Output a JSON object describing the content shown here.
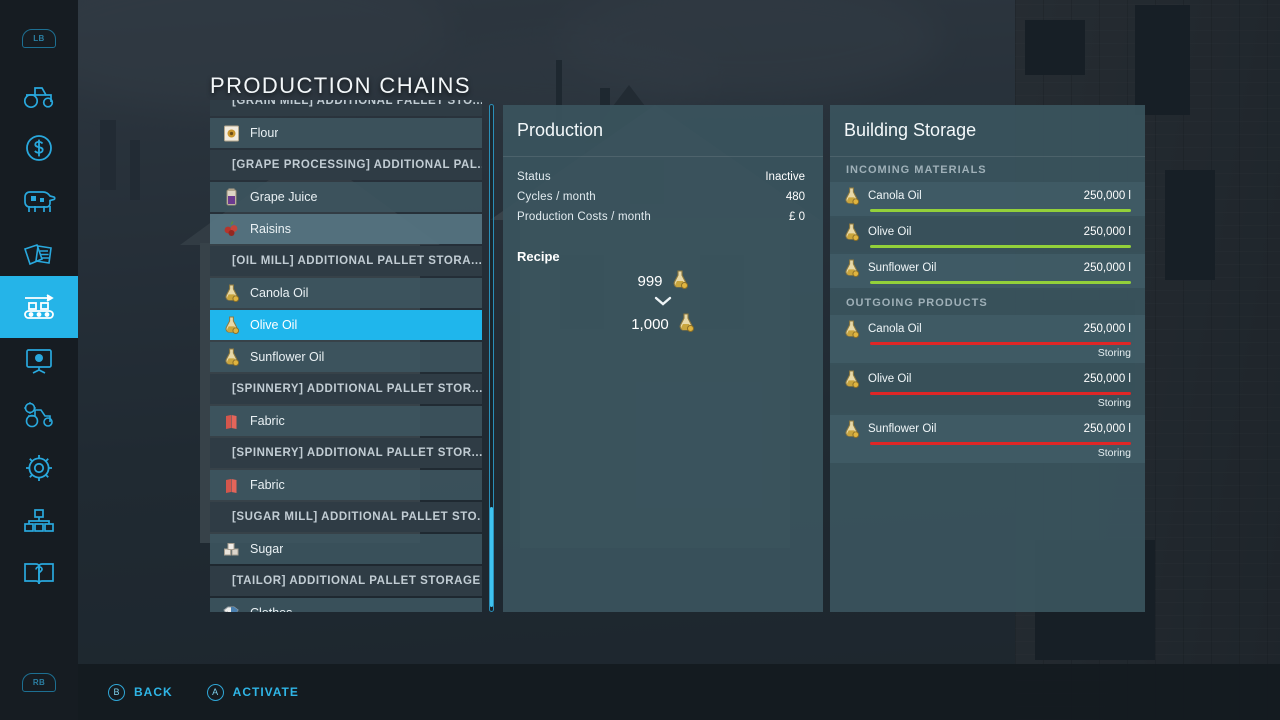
{
  "page_title": "PRODUCTION CHAINS",
  "sidebar": {
    "shoulder_top": "LB",
    "shoulder_bottom": "RB",
    "items": [
      {
        "icon": "tractor-icon",
        "label": "Vehicles"
      },
      {
        "icon": "dollar-coin-icon",
        "label": "Finances"
      },
      {
        "icon": "cow-icon",
        "label": "Animals"
      },
      {
        "icon": "documents-icon",
        "label": "Contracts"
      },
      {
        "icon": "production-chain-icon",
        "label": "Production Chains"
      },
      {
        "icon": "picture-frame-icon",
        "label": "Gallery"
      },
      {
        "icon": "tractor-settings-icon",
        "label": "Vehicle Settings"
      },
      {
        "icon": "gear-icon",
        "label": "Game Settings"
      },
      {
        "icon": "network-nodes-icon",
        "label": "Multiplayer"
      },
      {
        "icon": "help-book-icon",
        "label": "Help"
      }
    ],
    "active_index": 4
  },
  "list": {
    "rows": [
      {
        "type": "header",
        "label": "[GRAIN MILL] ADDITIONAL PALLET STO...",
        "state": "clipped"
      },
      {
        "type": "item",
        "label": "Flour",
        "icon": "flour-icon",
        "state": "normal"
      },
      {
        "type": "header",
        "label": "[GRAPE PROCESSING] ADDITIONAL PAL...",
        "state": "normal"
      },
      {
        "type": "item",
        "label": "Grape Juice",
        "icon": "grape-juice-icon",
        "state": "normal"
      },
      {
        "type": "item",
        "label": "Raisins",
        "icon": "raisins-icon",
        "state": "hover"
      },
      {
        "type": "header",
        "label": "[OIL MILL] ADDITIONAL PALLET STORA...",
        "state": "normal"
      },
      {
        "type": "item",
        "label": "Canola Oil",
        "icon": "oil-bottle-icon",
        "state": "normal"
      },
      {
        "type": "item",
        "label": "Olive Oil",
        "icon": "oil-bottle-icon",
        "state": "selected"
      },
      {
        "type": "item",
        "label": "Sunflower Oil",
        "icon": "oil-bottle-icon",
        "state": "normal"
      },
      {
        "type": "header",
        "label": "[SPINNERY] ADDITIONAL PALLET STOR...",
        "state": "normal"
      },
      {
        "type": "item",
        "label": "Fabric",
        "icon": "fabric-icon",
        "state": "normal"
      },
      {
        "type": "header",
        "label": "[SPINNERY] ADDITIONAL PALLET STOR...",
        "state": "normal"
      },
      {
        "type": "item",
        "label": "Fabric",
        "icon": "fabric-icon",
        "state": "normal"
      },
      {
        "type": "header",
        "label": "[SUGAR MILL] ADDITIONAL PALLET STO.",
        "state": "normal"
      },
      {
        "type": "item",
        "label": "Sugar",
        "icon": "sugar-icon",
        "state": "normal"
      },
      {
        "type": "header",
        "label": "[TAILOR] ADDITIONAL PALLET STORAGE",
        "state": "normal"
      },
      {
        "type": "item",
        "label": "Clothes",
        "icon": "clothes-icon",
        "state": "normal"
      }
    ]
  },
  "production": {
    "title": "Production",
    "stats": [
      {
        "key": "Status",
        "value": "Inactive"
      },
      {
        "key": "Cycles / month",
        "value": "480"
      },
      {
        "key": "Production Costs / month",
        "value": "£ 0"
      }
    ],
    "recipe_title": "Recipe",
    "recipe": {
      "input_amount": "999",
      "input_icon": "oil-bottle-icon",
      "arrow": "chevron-down-icon",
      "output_amount": "1,000",
      "output_icon": "oil-bottle-icon"
    }
  },
  "storage": {
    "title": "Building Storage",
    "incoming_label": "INCOMING MATERIALS",
    "outgoing_label": "OUTGOING PRODUCTS",
    "incoming": [
      {
        "name": "Canola Oil",
        "amount": "250,000 l",
        "icon": "oil-bottle-icon",
        "fill": 100,
        "bar_color": "#93d03a"
      },
      {
        "name": "Olive Oil",
        "amount": "250,000 l",
        "icon": "oil-bottle-icon",
        "fill": 100,
        "bar_color": "#93d03a"
      },
      {
        "name": "Sunflower Oil",
        "amount": "250,000 l",
        "icon": "oil-bottle-icon",
        "fill": 100,
        "bar_color": "#93d03a"
      }
    ],
    "outgoing": [
      {
        "name": "Canola Oil",
        "amount": "250,000 l",
        "icon": "oil-bottle-icon",
        "fill": 100,
        "bar_color": "#e02626",
        "state": "Storing"
      },
      {
        "name": "Olive Oil",
        "amount": "250,000 l",
        "icon": "oil-bottle-icon",
        "fill": 100,
        "bar_color": "#e02626",
        "state": "Storing"
      },
      {
        "name": "Sunflower Oil",
        "amount": "250,000 l",
        "icon": "oil-bottle-icon",
        "fill": 100,
        "bar_color": "#e02626",
        "state": "Storing"
      }
    ]
  },
  "footer": {
    "hints": [
      {
        "button": "B",
        "label": "BACK"
      },
      {
        "button": "A",
        "label": "ACTIVATE"
      }
    ]
  },
  "colors": {
    "accent": "#1fb6ec",
    "panel": "#3a545e",
    "header_row": "#2f3c45",
    "item_row": "#3d5560",
    "bar_green": "#93d03a",
    "bar_red": "#e02626"
  }
}
